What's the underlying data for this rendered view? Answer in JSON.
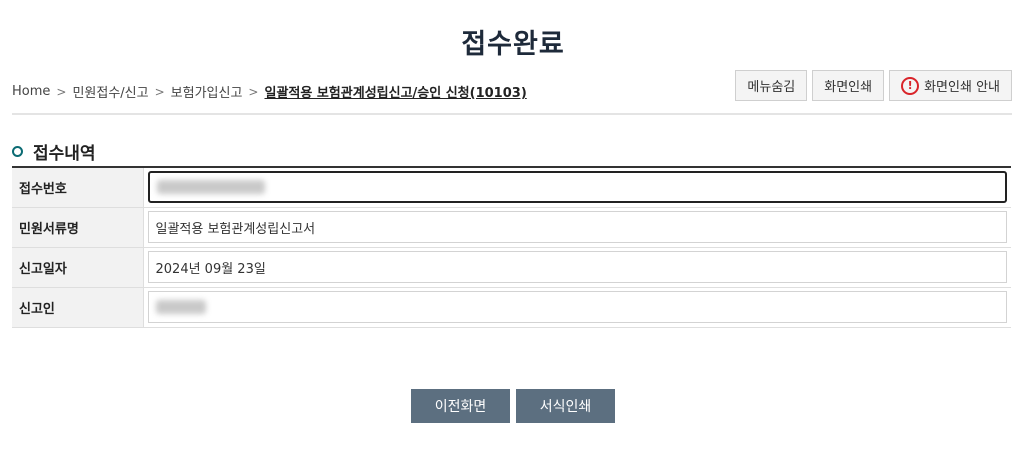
{
  "page": {
    "title": "접수완료"
  },
  "breadcrumb": {
    "items": [
      "Home",
      "민원접수/신고",
      "보험가입신고"
    ],
    "current": "일괄적용 보험관계성립신고/승인 신청(10103)",
    "separator": ">"
  },
  "toolbar": {
    "hide_menu_label": "메뉴숨김",
    "print_screen_label": "화면인쇄",
    "print_guide_label": "화면인쇄 안내",
    "warning_glyph": "!"
  },
  "section": {
    "title": "접수내역"
  },
  "receipt": {
    "rows": [
      {
        "label": "접수번호",
        "value": ""
      },
      {
        "label": "민원서류명",
        "value": "일괄적용 보험관계성립신고서"
      },
      {
        "label": "신고일자",
        "value": "2024년 09월 23일"
      },
      {
        "label": "신고인",
        "value": ""
      }
    ]
  },
  "actions": {
    "back_label": "이전화면",
    "print_form_label": "서식인쇄"
  },
  "colors": {
    "title": "#1e2a3a",
    "bullet": "#0b6b73",
    "warning": "#d9242a",
    "action_button": "#5c6f80"
  }
}
